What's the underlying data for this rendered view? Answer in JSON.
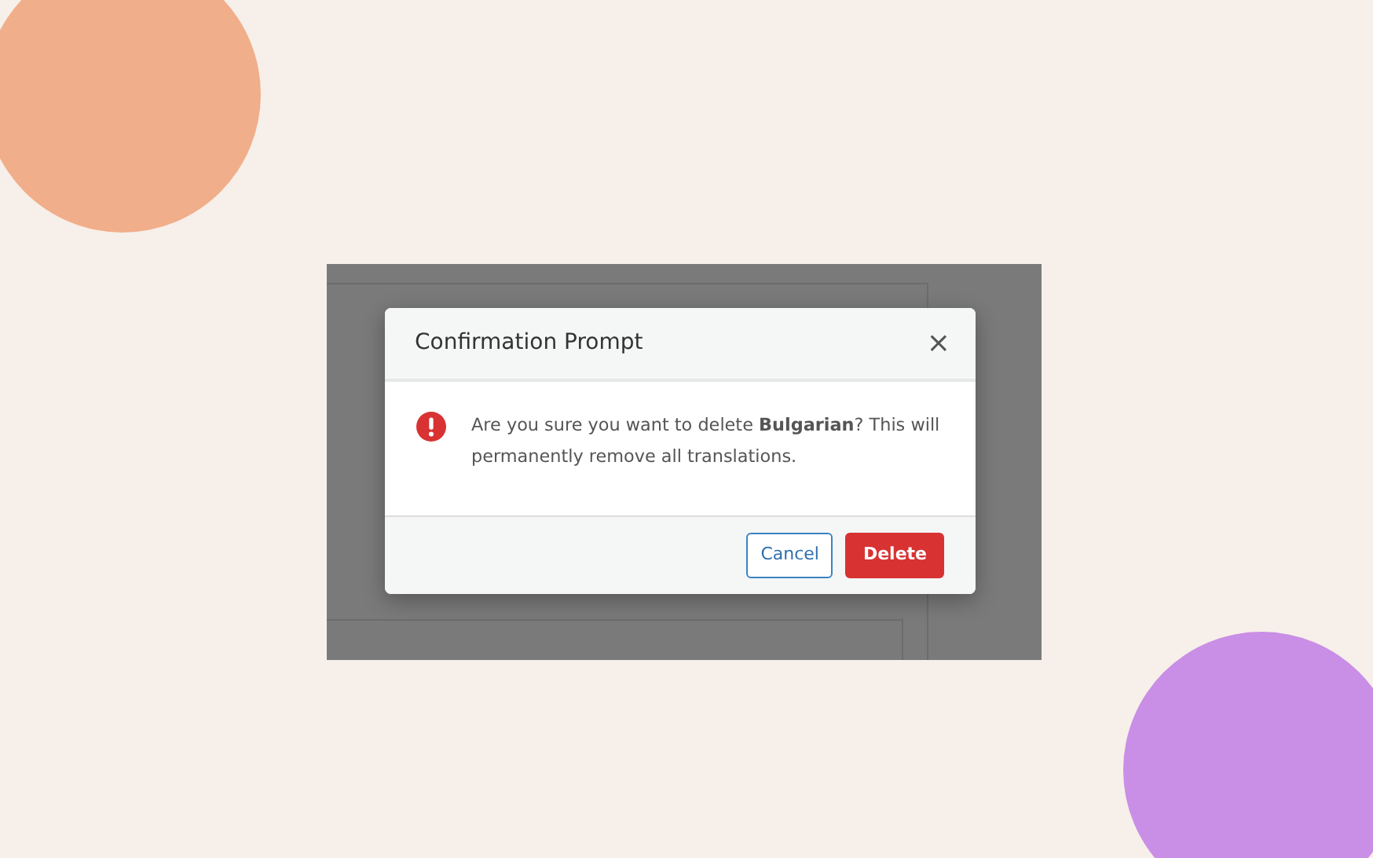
{
  "dialog": {
    "title": "Confirmation Prompt",
    "close": "×",
    "message": "Are you sure you want to delete **Bulgarian**? This will permanently remove all translations.",
    "buttons": [
      {
        "label": "Cancel",
        "kind": "secondary"
      },
      {
        "label": "Delete",
        "kind": "danger"
      }
    ]
  }
}
